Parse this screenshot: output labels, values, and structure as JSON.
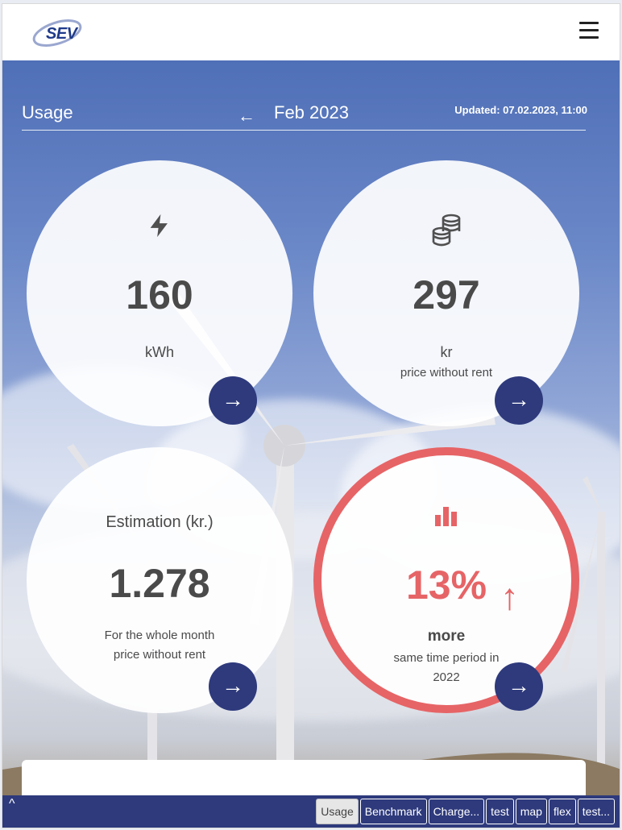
{
  "header": {
    "logo_text": "SEV"
  },
  "usage": {
    "title": "Usage",
    "back_arrow": "←",
    "month": "Feb 2023",
    "updated": "Updated: 07.02.2023, 11:00"
  },
  "cards": {
    "energy": {
      "icon": "bolt-icon",
      "value": "160",
      "unit": "kWh"
    },
    "price": {
      "icon": "coins-icon",
      "value": "297",
      "unit": "kr",
      "note": "price without rent"
    },
    "estimation": {
      "title": "Estimation (kr.)",
      "value": "1.278",
      "note1": "For the whole month",
      "note2": "price without rent"
    },
    "comparison": {
      "icon": "bar-chart-icon",
      "value": "13%",
      "trend_arrow": "↑",
      "label": "more",
      "note1": "same time period in",
      "note2": "2022"
    }
  },
  "arrow_glyph": "→",
  "tabbar": {
    "up_glyph": "^",
    "tabs": [
      "Usage",
      "Benchmark",
      "Charge...",
      "test",
      "map",
      "flex",
      "test..."
    ],
    "active": "Usage"
  },
  "colors": {
    "accent": "#2e3a7c",
    "alert": "#e66466"
  }
}
